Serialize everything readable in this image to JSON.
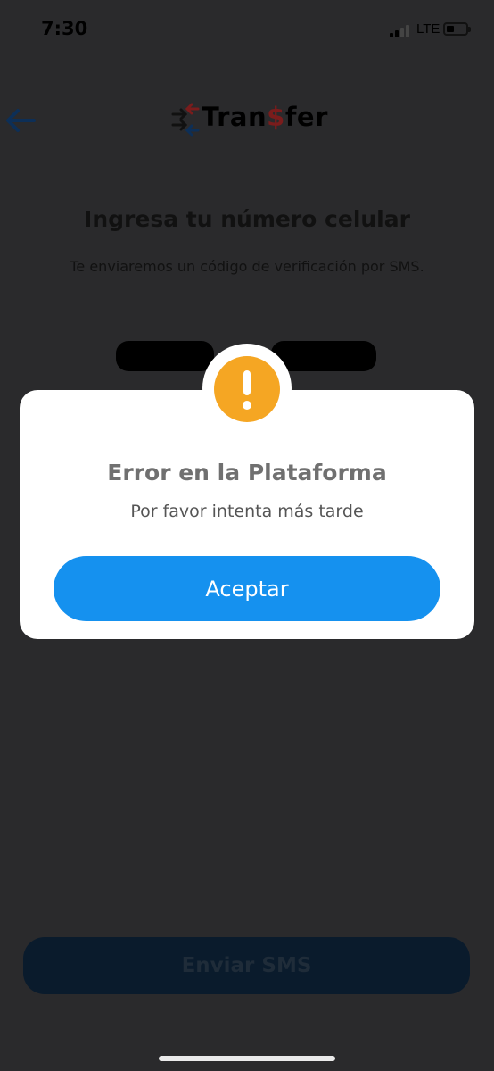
{
  "status_bar": {
    "time": "7:30",
    "network": "LTE",
    "battery_level": 0.25
  },
  "header": {
    "back_icon": "arrow-left-icon",
    "logo_text_pre": "Tran",
    "logo_text_dollar": "$",
    "logo_text_post": "fer",
    "logo_icon": "transfer-arrows-icon"
  },
  "page": {
    "title": "Ingresa tu número celular",
    "subtitle": "Te enviaremos un código de verificación por SMS."
  },
  "modal": {
    "icon": "exclamation-icon",
    "title": "Error en la Plataforma",
    "message": "Por favor intenta más tarde",
    "accept_label": "Aceptar",
    "accent_color": "#1591ef",
    "alert_color": "#f5a623"
  },
  "footer": {
    "send_sms_label": "Enviar SMS"
  }
}
